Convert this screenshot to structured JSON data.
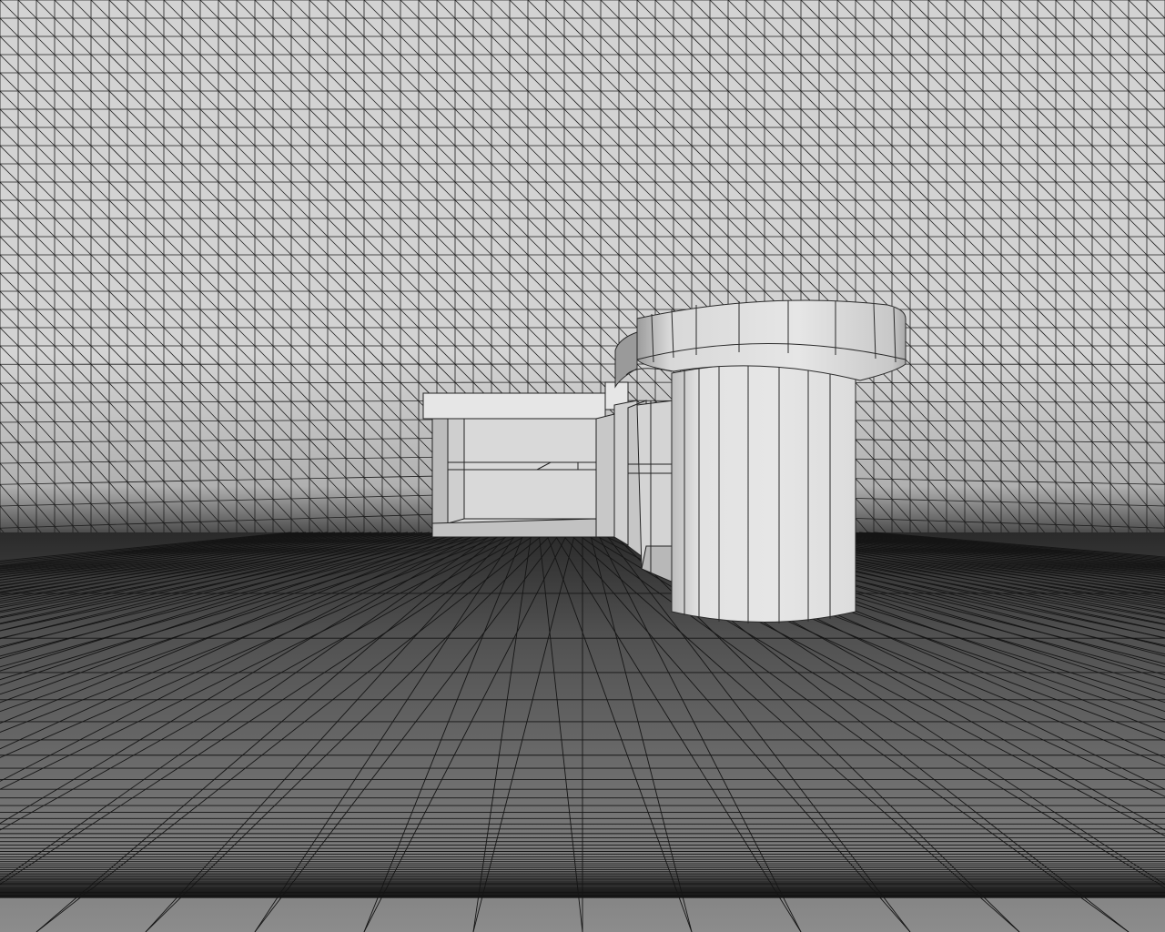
{
  "scene": {
    "backdrop_color": "#d2d2d2",
    "floor_color_far": "#2e2e2e",
    "floor_color_near": "#8a8a8a",
    "wire_color": "#1a1a1a",
    "model_face_light": "#e4e4e4",
    "model_face_mid": "#cfcfcf",
    "model_face_dark": "#9a9a9a",
    "objects": [
      "box-module",
      "stepped-connector",
      "cylinder-column",
      "cylinder-cap"
    ]
  }
}
